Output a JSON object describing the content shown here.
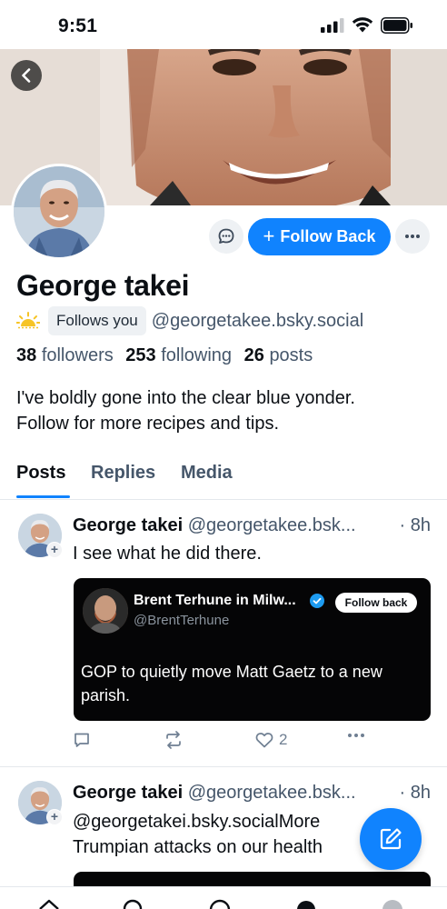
{
  "status_bar": {
    "time": "9:51"
  },
  "profile": {
    "display_name": "George takei",
    "follows_you": "Follows you",
    "handle": "@georgetakee.bsky.social",
    "followers_count": "38",
    "followers_label": "followers",
    "following_count": "253",
    "following_label": "following",
    "posts_count": "26",
    "posts_label": "posts",
    "bio_line1": "I've boldly gone into the clear blue yonder.",
    "bio_line2": "Follow for more recipes and tips.",
    "follow_button": "Follow Back"
  },
  "tabs": [
    "Posts",
    "Replies",
    "Media"
  ],
  "posts": [
    {
      "name": "George takei",
      "handle": "@georgetakee.bsk...",
      "time": "· 8h",
      "text": "I see what he did there.",
      "quote": {
        "name": "Brent Terhune in Milw...",
        "handle": "@BrentTerhune",
        "follow_label": "Follow back",
        "text": "GOP to quietly move Matt Gaetz to a new parish."
      },
      "likes": "2"
    },
    {
      "name": "George takei",
      "handle": "@georgetakee.bsk...",
      "time": "· 8h",
      "text_line1": "@georgetakei.bsky.socialMore",
      "text_line2": "Trumpian attacks on our health"
    }
  ],
  "colors": {
    "accent": "#1083fe",
    "muted_text": "#45566a",
    "quote_bg": "#050506"
  }
}
